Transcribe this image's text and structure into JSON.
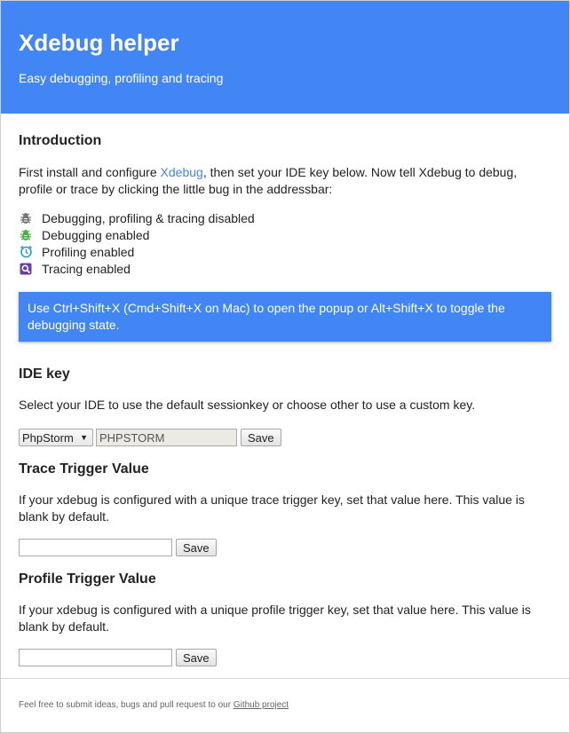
{
  "header": {
    "title": "Xdebug helper",
    "subtitle": "Easy debugging, profiling and tracing"
  },
  "intro": {
    "title": "Introduction",
    "text_before_link": "First install and configure ",
    "link_label": "Xdebug",
    "text_after_link": ", then set your IDE key below. Now tell Xdebug to debug, profile or trace by clicking the little bug in the addressbar:",
    "statuses": [
      {
        "icon": "bug-icon-disabled",
        "label": "Debugging, profiling & tracing disabled",
        "color": "#757575"
      },
      {
        "icon": "bug-icon-enabled",
        "label": "Debugging enabled",
        "color": "#3eb13e"
      },
      {
        "icon": "clock-icon",
        "label": "Profiling enabled",
        "color": "#2c9ad6"
      },
      {
        "icon": "magnifier-icon",
        "label": "Tracing enabled",
        "color": "#6b3fa0"
      }
    ]
  },
  "notice": {
    "text": "Use Ctrl+Shift+X (Cmd+Shift+X on Mac) to open the popup or Alt+Shift+X to toggle the debugging state."
  },
  "ide": {
    "title": "IDE key",
    "text": "Select your IDE to use the default sessionkey or choose other to use a custom key.",
    "selected_ide": "PhpStorm",
    "key_value": "PHPSTORM",
    "save_label": "Save"
  },
  "trace": {
    "title": "Trace Trigger Value",
    "text": "If your xdebug is configured with a unique trace trigger key, set that value here. This value is blank by default.",
    "value": "",
    "save_label": "Save"
  },
  "profile": {
    "title": "Profile Trigger Value",
    "text": "If your xdebug is configured with a unique profile trigger key, set that value here. This value is blank by default.",
    "value": "",
    "save_label": "Save"
  },
  "footer": {
    "text": "Feel free to submit ideas, bugs and pull request to our ",
    "link_label": "Github project"
  },
  "colors": {
    "accent": "#4285f4"
  }
}
